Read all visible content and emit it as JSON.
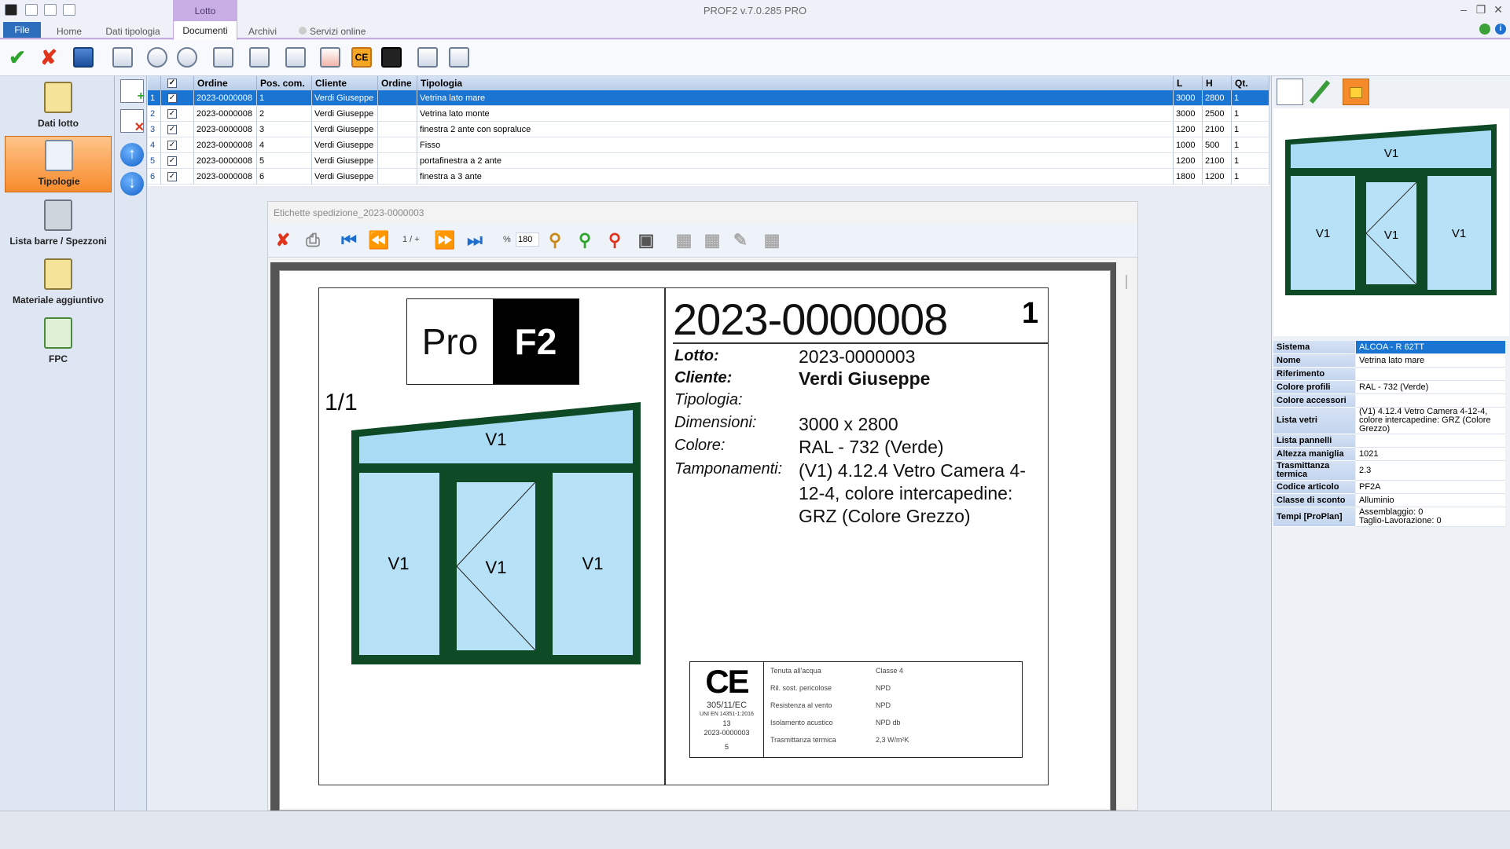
{
  "app": {
    "title": "PROF2 v.7.0.285 PRO"
  },
  "ribbon": {
    "context_tab": "Lotto",
    "tabs": [
      "File",
      "Home",
      "Dati tipologia",
      "Documenti",
      "Archivi",
      "Servizi online"
    ],
    "active_tab": "Documenti"
  },
  "sidebar": {
    "items": [
      {
        "label": "Dati lotto"
      },
      {
        "label": "Tipologie"
      },
      {
        "label": "Lista barre / Spezzoni"
      },
      {
        "label": "Materiale aggiuntivo"
      },
      {
        "label": "FPC"
      }
    ],
    "active": "Tipologie"
  },
  "grid": {
    "columns": [
      "Ordine",
      "Pos. com.",
      "Cliente",
      "Ordine",
      "Tipologia",
      "L",
      "H",
      "Qt."
    ],
    "rows": [
      {
        "n": "1",
        "ordine": "2023-0000008",
        "pos": "1",
        "cliente": "Verdi Giuseppe",
        "ordine2": "",
        "tipologia": "Vetrina lato mare",
        "l": "3000",
        "h": "2800",
        "qt": "1"
      },
      {
        "n": "2",
        "ordine": "2023-0000008",
        "pos": "2",
        "cliente": "Verdi Giuseppe",
        "ordine2": "",
        "tipologia": "Vetrina lato monte",
        "l": "3000",
        "h": "2500",
        "qt": "1"
      },
      {
        "n": "3",
        "ordine": "2023-0000008",
        "pos": "3",
        "cliente": "Verdi Giuseppe",
        "ordine2": "",
        "tipologia": "finestra 2 ante con sopraluce",
        "l": "1200",
        "h": "2100",
        "qt": "1"
      },
      {
        "n": "4",
        "ordine": "2023-0000008",
        "pos": "4",
        "cliente": "Verdi Giuseppe",
        "ordine2": "",
        "tipologia": "Fisso",
        "l": "1000",
        "h": "500",
        "qt": "1"
      },
      {
        "n": "5",
        "ordine": "2023-0000008",
        "pos": "5",
        "cliente": "Verdi Giuseppe",
        "ordine2": "",
        "tipologia": "portafinestra a 2 ante",
        "l": "1200",
        "h": "2100",
        "qt": "1"
      },
      {
        "n": "6",
        "ordine": "2023-0000008",
        "pos": "6",
        "cliente": "Verdi Giuseppe",
        "ordine2": "",
        "tipologia": "finestra a 3 ante",
        "l": "1800",
        "h": "1200",
        "qt": "1"
      }
    ]
  },
  "viewer": {
    "title": "Etichette spedizione_2023-0000003",
    "page_indicator": "1 / +",
    "zoom_prefix": "%",
    "zoom": "180"
  },
  "label": {
    "logo_left": "Pro",
    "logo_right": "F2",
    "page_counter": "1/1",
    "code": "2023-0000008",
    "number": "1",
    "fields": [
      {
        "key": "Lotto:",
        "value": "2023-0000003"
      },
      {
        "key": "Cliente:",
        "value": "Verdi Giuseppe"
      },
      {
        "key": "Tipologia:",
        "value": ""
      },
      {
        "key": "Dimensioni:",
        "value": "3000 x 2800"
      },
      {
        "key": "Colore:",
        "value": "RAL - 732 (Verde)"
      },
      {
        "key": "Tamponamenti:",
        "value": "(V1) 4.12.4  Vetro Camera 4-12-4, colore intercapedine: GRZ (Colore Grezzo)"
      }
    ],
    "glass_label": "V1",
    "ce": {
      "mark": "CE",
      "regulation": "305/11/EC",
      "norm": "UNI EN 14351-1:2016",
      "year": "13",
      "code": "2023-0000003",
      "num": "5",
      "rows": [
        {
          "k": "Tenuta all'acqua",
          "v": "Classe 4"
        },
        {
          "k": "Ril. sost. pericolose",
          "v": "NPD"
        },
        {
          "k": "Resistenza al vento",
          "v": "NPD"
        },
        {
          "k": "Isolamento acustico",
          "v": "NPD db"
        },
        {
          "k": "Trasmittanza termica",
          "v": "2,3 W/m²K"
        }
      ]
    }
  },
  "properties": [
    {
      "k": "Sistema",
      "v": "ALCOA - R 62TT",
      "sel": true
    },
    {
      "k": "Nome",
      "v": "Vetrina lato mare"
    },
    {
      "k": "Riferimento",
      "v": ""
    },
    {
      "k": "Colore profili",
      "v": "RAL - 732 (Verde)"
    },
    {
      "k": "Colore accessori",
      "v": ""
    },
    {
      "k": "Lista vetri",
      "v": "(V1) 4.12.4  Vetro Camera 4-12-4, colore intercapedine: GRZ (Colore Grezzo)"
    },
    {
      "k": "Lista pannelli",
      "v": ""
    },
    {
      "k": "Altezza maniglia",
      "v": "1021"
    },
    {
      "k": "Trasmittanza termica",
      "v": "2.3"
    },
    {
      "k": "Codice articolo",
      "v": "PF2A"
    },
    {
      "k": "Classe di sconto",
      "v": "Alluminio"
    },
    {
      "k": "Tempi [ProPlan]",
      "v": "Assemblaggio: 0\nTaglio-Lavorazione: 0"
    }
  ],
  "colors": {
    "accent": "#1a74d2",
    "frame_green": "#0f4a26",
    "glass": "#a9dbf5",
    "nav_active": "#f68b2c"
  }
}
